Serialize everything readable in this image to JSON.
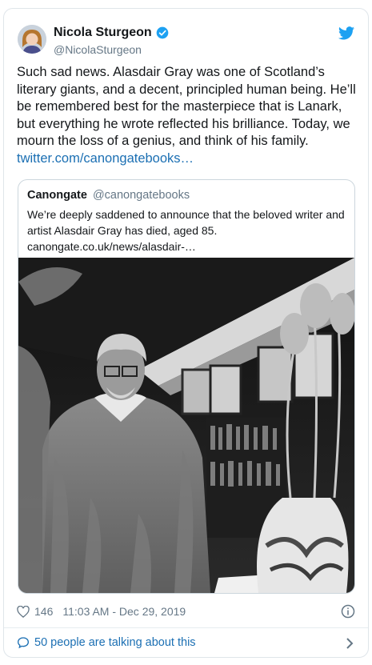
{
  "author": {
    "name": "Nicola Sturgeon",
    "handle": "@NicolaSturgeon"
  },
  "tweet": {
    "text": "Such sad news. Alasdair Gray was one of Scotland’s literary giants, and a decent, principled human being. He’ll be remembered best for the masterpiece that is Lanark, but everything he wrote reflected his brilliance. Today, we mourn the loss of a genius, and think of his family.",
    "link": "twitter.com/canongatebooks…"
  },
  "quote": {
    "name": "Canongate",
    "handle": "@canongatebooks",
    "text": "We’re deeply saddened to announce that the beloved writer and artist Alasdair Gray has died, aged 85.",
    "link": "canongate.co.uk/news/alasdair-…"
  },
  "footer": {
    "likes": "146",
    "timestamp": "11:03 AM - Dec 29, 2019",
    "talking": "50 people are talking about this"
  },
  "icons": {
    "verified": "verified-badge-icon",
    "twitter": "twitter-bird-icon",
    "heart": "heart-icon",
    "info": "info-icon",
    "bubble": "speech-bubble-icon",
    "chevron": "chevron-right-icon"
  },
  "colors": {
    "link": "#1b6fb3",
    "twitter_blue": "#1da1f2",
    "muted": "#657786"
  }
}
